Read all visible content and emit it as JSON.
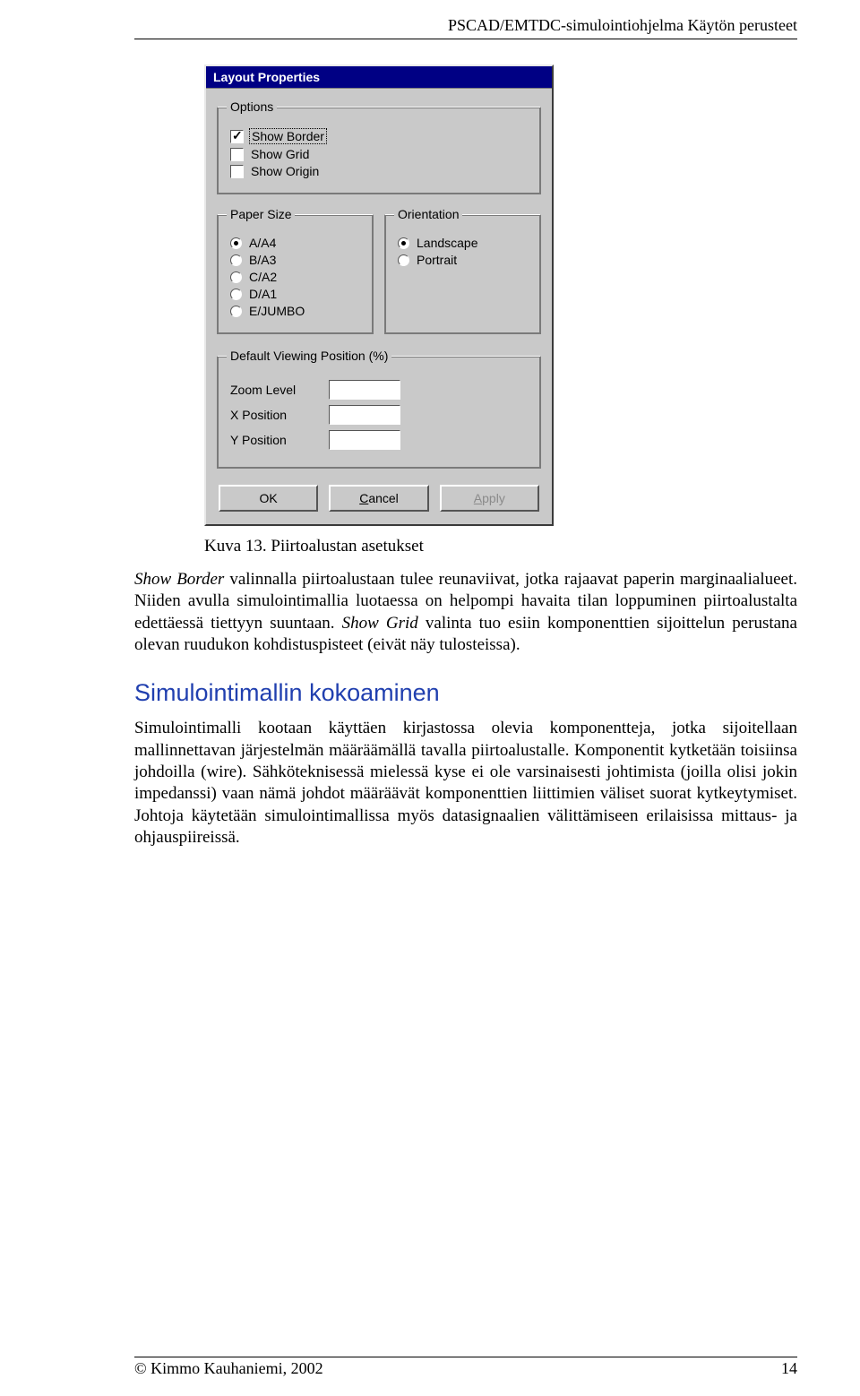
{
  "running_head": "PSCAD/EMTDC-simulointiohjelma Käytön perusteet",
  "dialog": {
    "title": "Layout Properties",
    "options": {
      "legend": "Options",
      "items": [
        {
          "label": "Show Border",
          "checked": true
        },
        {
          "label": "Show Grid",
          "checked": false
        },
        {
          "label": "Show Origin",
          "checked": false
        }
      ]
    },
    "paper_size": {
      "legend": "Paper Size",
      "items": [
        {
          "label": "A/A4",
          "selected": true
        },
        {
          "label": "B/A3",
          "selected": false
        },
        {
          "label": "C/A2",
          "selected": false
        },
        {
          "label": "D/A1",
          "selected": false
        },
        {
          "label": "E/JUMBO",
          "selected": false
        }
      ]
    },
    "orientation": {
      "legend": "Orientation",
      "items": [
        {
          "label": "Landscape",
          "selected": true
        },
        {
          "label": "Portrait",
          "selected": false
        }
      ]
    },
    "viewing": {
      "legend": "Default Viewing Position (%)",
      "fields": [
        {
          "label": "Zoom Level",
          "value": ""
        },
        {
          "label": "X Position",
          "value": ""
        },
        {
          "label": "Y Position",
          "value": ""
        }
      ]
    },
    "buttons": {
      "ok": "OK",
      "cancel_prefix": "C",
      "cancel_rest": "ancel",
      "apply_prefix": "A",
      "apply_rest": "pply"
    }
  },
  "caption": "Kuva 13. Piirtoalustan asetukset",
  "para1_a": "Show Border",
  "para1_b": " valinnalla piirtoalustaan tulee reunaviivat, jotka rajaavat paperin marginaalialueet. Niiden avulla simulointimallia luotaessa on helpompi havaita tilan loppuminen piirtoalustalta edettäessä tiettyyn suuntaan. ",
  "para1_c": "Show Grid",
  "para1_d": " valinta tuo esiin komponenttien sijoittelun perustana olevan ruudukon kohdistuspisteet (eivät näy tulosteissa).",
  "section_heading": "Simulointimallin kokoaminen",
  "para2": "Simulointimalli kootaan käyttäen kirjastossa olevia komponentteja, jotka sijoitellaan mallinnettavan järjestelmän määräämällä tavalla piirtoalustalle. Komponentit kytketään toisiinsa johdoilla (wire). Sähköteknisessä mielessä kyse ei ole varsinaisesti johtimista (joilla olisi jokin impedanssi) vaan nämä johdot määräävät komponenttien liittimien väliset suorat kytkeytymiset. Johtoja käytetään simulointimallissa myös datasignaalien välittämiseen erilaisissa mittaus- ja ohjauspiireissä.",
  "footer_left": "© Kimmo Kauhaniemi, 2002",
  "footer_right": "14"
}
